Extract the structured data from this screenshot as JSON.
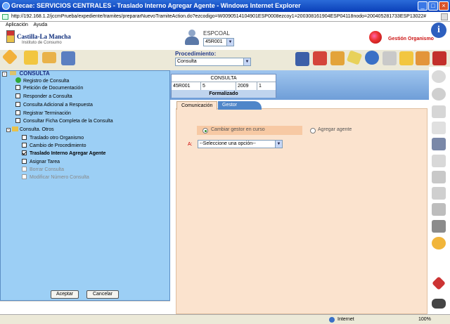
{
  "window": {
    "title": "Grecae: SERVICIOS CENTRALES - Traslado Interno Agregar Agente - Windows Internet Explorer"
  },
  "address": {
    "url": "http://192.168.1.2/jccmPrueba/expediente/tramites/prepararNuevoTramiteAction.do?ezcodigo=W0090514104901ESP0008ezcoy1=200308161904ESP04118nodo=200405281733ESP13022#"
  },
  "menubar": {
    "items": [
      "Aplicación",
      "Ayuda"
    ]
  },
  "header": {
    "org_name": "Castilla-La Mancha",
    "org_sub": "Instituto de Consumo",
    "user_group": "ESPCOAL",
    "user_select_value": "45R001",
    "gestor_label": "Gestión Organismo",
    "info_glyph": "i"
  },
  "procedimiento": {
    "label": "Procedimiento:",
    "value": "Consulta"
  },
  "consulta": {
    "header": "CONSULTA",
    "cells": [
      "45R001",
      "5",
      "2009",
      "1"
    ],
    "status": "Formalizado"
  },
  "tabs": {
    "comunicacion": "Comunicación",
    "gestor": "Gestor"
  },
  "form": {
    "radio_cambiar": "Cambiar gestor en curso",
    "radio_agregar": "Agregar agente",
    "a_label": "A:",
    "select_placeholder": "--Seleccione una opción--"
  },
  "tree": {
    "root": "CONSULTA",
    "items": [
      {
        "label": "Registro de Consulta"
      },
      {
        "label": "Petición de Documentación"
      },
      {
        "label": "Responder a Consulta"
      },
      {
        "label": "Consulta Adicional a Respuesta"
      },
      {
        "label": "Registrar Terminación"
      },
      {
        "label": "Consultar Ficha Completa de la Consulta"
      }
    ],
    "folder": "Consulta. Otros",
    "sub_items": [
      {
        "label": "Traslado otro Organismo"
      },
      {
        "label": "Cambio de Procedimiento"
      },
      {
        "label": "Traslado Interno Agregar Agente"
      },
      {
        "label": "Asignar Tarea"
      },
      {
        "label": "Borrar Consulta"
      },
      {
        "label": "Modificar Número Consulta"
      }
    ]
  },
  "buttons": {
    "aceptar": "Aceptar",
    "cancelar": "Cancelar"
  },
  "statusbar": {
    "zone": "Internet",
    "zoom": "100%"
  },
  "colors": {
    "panel": "#9ccff5",
    "peach": "#fbe3ce",
    "tab_active": "#4f86c9",
    "title_bar": "#0a3fb8"
  }
}
